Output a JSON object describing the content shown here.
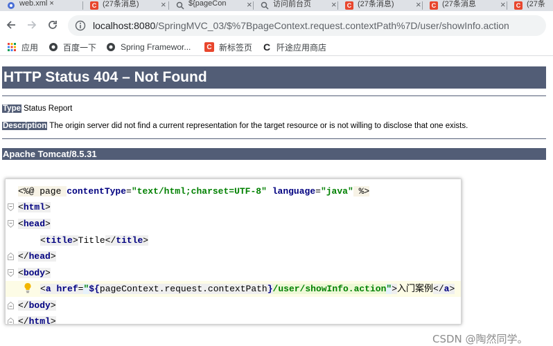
{
  "tabs": [
    {
      "icon": "web-icon",
      "title": "web.xml ×"
    },
    {
      "icon": "csdn-c-icon",
      "title": "(27条消息)"
    },
    {
      "icon": "web-icon",
      "title": "${pageCon"
    },
    {
      "icon": "web-icon",
      "title": "访问前台页"
    },
    {
      "icon": "csdn-c-icon",
      "title": "(27条消息)"
    },
    {
      "icon": "csdn-c-icon",
      "title": "(27条消息"
    },
    {
      "icon": "csdn-c-icon",
      "title": "(27条"
    }
  ],
  "toolbar": {
    "url_host": "localhost:8080",
    "url_path": "/SpringMVC_03/$%7BpageContext.request.contextPath%7D/user/showInfo.action"
  },
  "bookmarks": [
    {
      "icon": "apps-grid-icon",
      "label": "应用"
    },
    {
      "icon": "globe-icon",
      "label": "百度一下"
    },
    {
      "icon": "globe-icon",
      "label": "Spring Framewor..."
    },
    {
      "icon": "csdn-c-icon",
      "label": "新标签页"
    },
    {
      "icon": "c-logo-icon",
      "label": "阡途应用商店"
    }
  ],
  "error": {
    "title": "HTTP Status 404 – Not Found",
    "type_label": "Type",
    "type_value": "Status Report",
    "desc_label": "Description",
    "desc_value": "The origin server did not find a current representation for the target resource or is not willing to disclose that one exists.",
    "server": "Apache Tomcat/8.5.31"
  },
  "code": {
    "l1_open": "<%@ page ",
    "l1_attr1": "contentType",
    "l1_val1": "\"text/html;charset=UTF-8\"",
    "l1_attr2": "language",
    "l1_val2": "\"java\"",
    "l1_close": " %>",
    "html_tag": "html",
    "head_tag": "head",
    "title_tag": "title",
    "title_text": "Title",
    "body_tag": "body",
    "a_tag": "a",
    "a_attr": "href",
    "a_quote": "\"",
    "a_expr_start": "${",
    "a_expr": "pageContext.request.contextPath",
    "a_expr_end": "}",
    "a_path": "/user/showInfo.action",
    "a_text": "入门案例"
  },
  "watermark": "CSDN @陶然同学。",
  "colors": {
    "tomcat_header": "#525d76",
    "tab_strip": "#dee1e6",
    "omnibox": "#f1f3f4",
    "csdn_red": "#e8462d"
  }
}
